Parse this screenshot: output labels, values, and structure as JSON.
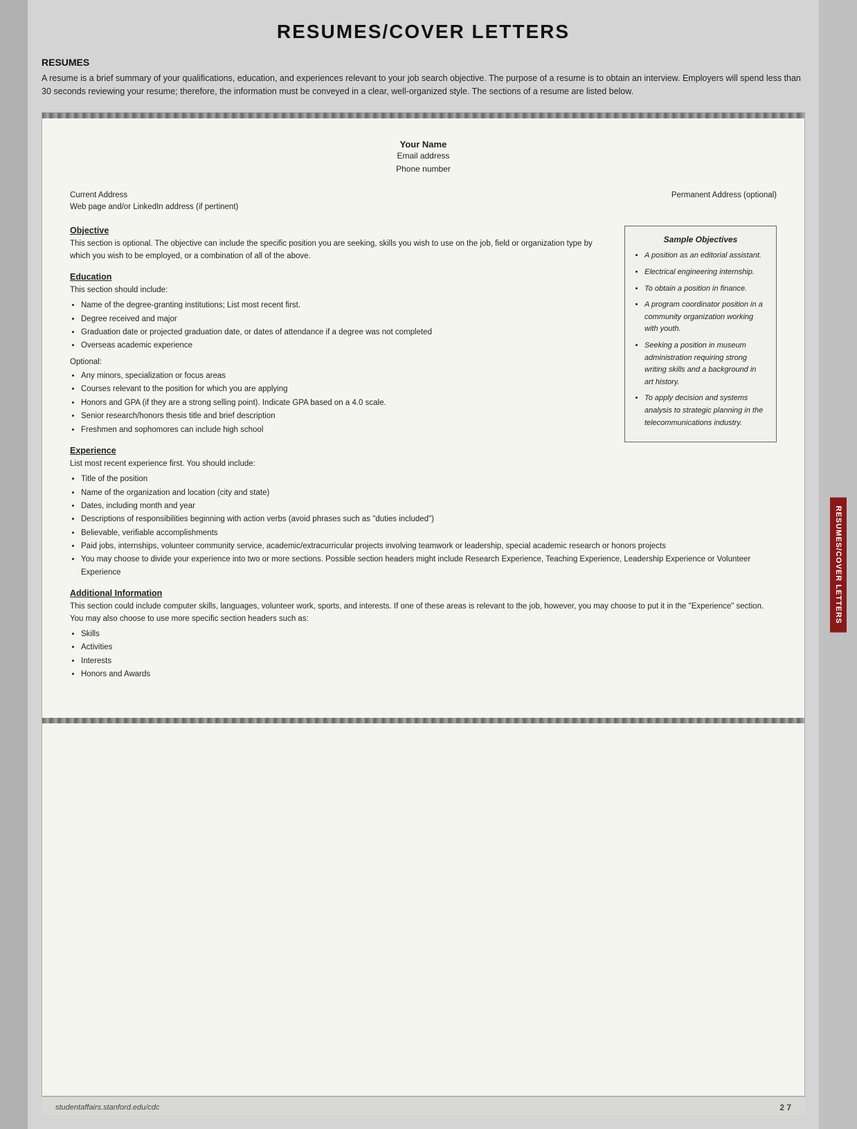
{
  "page": {
    "title": "RESUMES/COVER LETTERS",
    "sidebar_label": "RESUMES/COVER LETTERS",
    "footer_url": "studentaffairs.stanford.edu/cdc",
    "footer_page": "2 7"
  },
  "resumes_section": {
    "heading": "RESUMES",
    "intro": "A resume is a brief summary of your qualifications, education, and experiences relevant to your job search objective. The purpose of a resume is to obtain an interview. Employers will spend less than 30 seconds reviewing your resume; therefore, the information must be conveyed in a clear, well-organized style. The sections of a resume are listed below."
  },
  "document": {
    "your_name": "Your Name",
    "email": "Email address",
    "phone": "Phone number",
    "current_address": "Current Address",
    "web_address": "Web page and/or LinkedIn address (if pertinent)",
    "permanent_address": "Permanent Address (optional)",
    "objective_title": "Objective",
    "objective_text": "This section is optional. The objective can include the specific position you are seeking, skills you wish to use on the job, field or organization type by which you wish to be employed, or a combination of all of the above.",
    "education_title": "Education",
    "education_intro": "This section should include:",
    "education_items": [
      "Name of the degree-granting institutions; List most recent first.",
      "Degree received and major",
      "Graduation date or projected graduation date, or dates of attendance if a degree was not completed",
      "Overseas academic experience"
    ],
    "optional_label": "Optional:",
    "optional_items": [
      "Any minors, specialization or focus areas",
      "Courses relevant to the position for which you are applying",
      "Honors and GPA (if they are a strong selling point). Indicate GPA based on a 4.0 scale.",
      "Senior research/honors thesis title and brief description",
      "Freshmen and sophomores can include high school"
    ],
    "experience_title": "Experience",
    "experience_intro": "List most recent experience first. You should include:",
    "experience_items": [
      "Title of the position",
      "Name of the organization and location (city and state)",
      "Dates, including month and year",
      "Descriptions of responsibilities beginning with action verbs (avoid phrases such as \"duties included\")",
      "Believable, verifiable accomplishments",
      "Paid jobs, internships, volunteer community service, academic/extracurricular projects involving teamwork or leadership, special academic research or honors projects",
      "You may choose to divide your experience into two or more sections. Possible section headers might include Research Experience, Teaching Experience, Leadership Experience or Volunteer Experience"
    ],
    "additional_title": "Additional Information",
    "additional_text": "This section could include computer skills, languages, volunteer work, sports, and interests. If one of these areas is relevant to the job, however, you may choose to put it in the \"Experience\" section. You may also choose to use more specific section headers such as:",
    "additional_items": [
      "Skills",
      "Activities",
      "Interests",
      "Honors and Awards"
    ]
  },
  "sample_objectives": {
    "title": "Sample Objectives",
    "items": [
      "A position as an editorial assistant.",
      "Electrical engineering internship.",
      "To obtain a position in finance.",
      "A program coordinator position in a community organization working with youth.",
      "Seeking a position in museum administration requiring strong writing skills and a background in art history.",
      "To apply decision and systems analysis to strategic planning in the telecommunications industry."
    ]
  }
}
